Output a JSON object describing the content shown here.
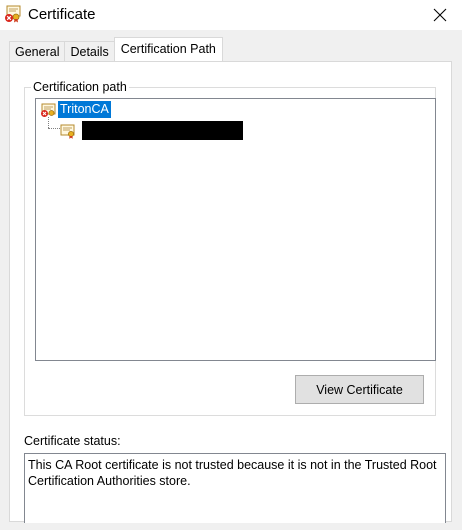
{
  "window": {
    "title": "Certificate",
    "icon": "certificate-error-icon",
    "close_icon": "close-icon"
  },
  "tabs": [
    {
      "label": "General",
      "active": false
    },
    {
      "label": "Details",
      "active": false
    },
    {
      "label": "Certification Path",
      "active": true
    }
  ],
  "cert_path": {
    "group_label": "Certification path",
    "root": {
      "label": "TritonCA",
      "icon": "certificate-error-icon",
      "selected": true
    },
    "child": {
      "label": "",
      "icon": "certificate-icon",
      "redacted": true
    }
  },
  "view_button_label": "View Certificate",
  "status": {
    "label": "Certificate status:",
    "text": "This CA Root certificate is not trusted because it is not in the Trusted Root Certification Authorities store."
  },
  "colors": {
    "selection": "#0078d7",
    "dialog_bg": "#f0f0f0",
    "button_bg": "#e1e1e1"
  }
}
